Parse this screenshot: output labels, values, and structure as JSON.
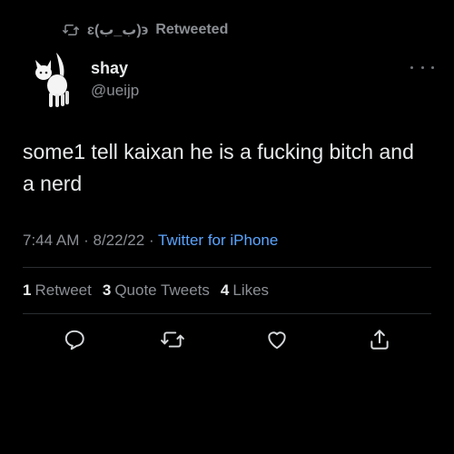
{
  "retweet": {
    "user": "ɛ(ب_ب)϶",
    "label": "Retweeted",
    "icon": "retweet-icon"
  },
  "author": {
    "name": "shay",
    "handle": "@ueijp",
    "avatar_icon": "white-kitten-avatar"
  },
  "tweet": {
    "text": "some1 tell kaixan he is a fucking bitch and a nerd",
    "time": "7:44 AM",
    "date": "8/22/22",
    "source": "Twitter for iPhone",
    "separator": " · "
  },
  "stats": {
    "retweets_count": "1",
    "retweets_label": "Retweet",
    "quotes_count": "3",
    "quotes_label": "Quote Tweets",
    "likes_count": "4",
    "likes_label": "Likes"
  },
  "actions": [
    "reply-icon",
    "retweet-icon",
    "like-icon",
    "share-icon"
  ],
  "colors": {
    "background": "#000000",
    "text": "#e7e9ea",
    "muted": "#8b8f94",
    "link": "#5aa5ff"
  }
}
